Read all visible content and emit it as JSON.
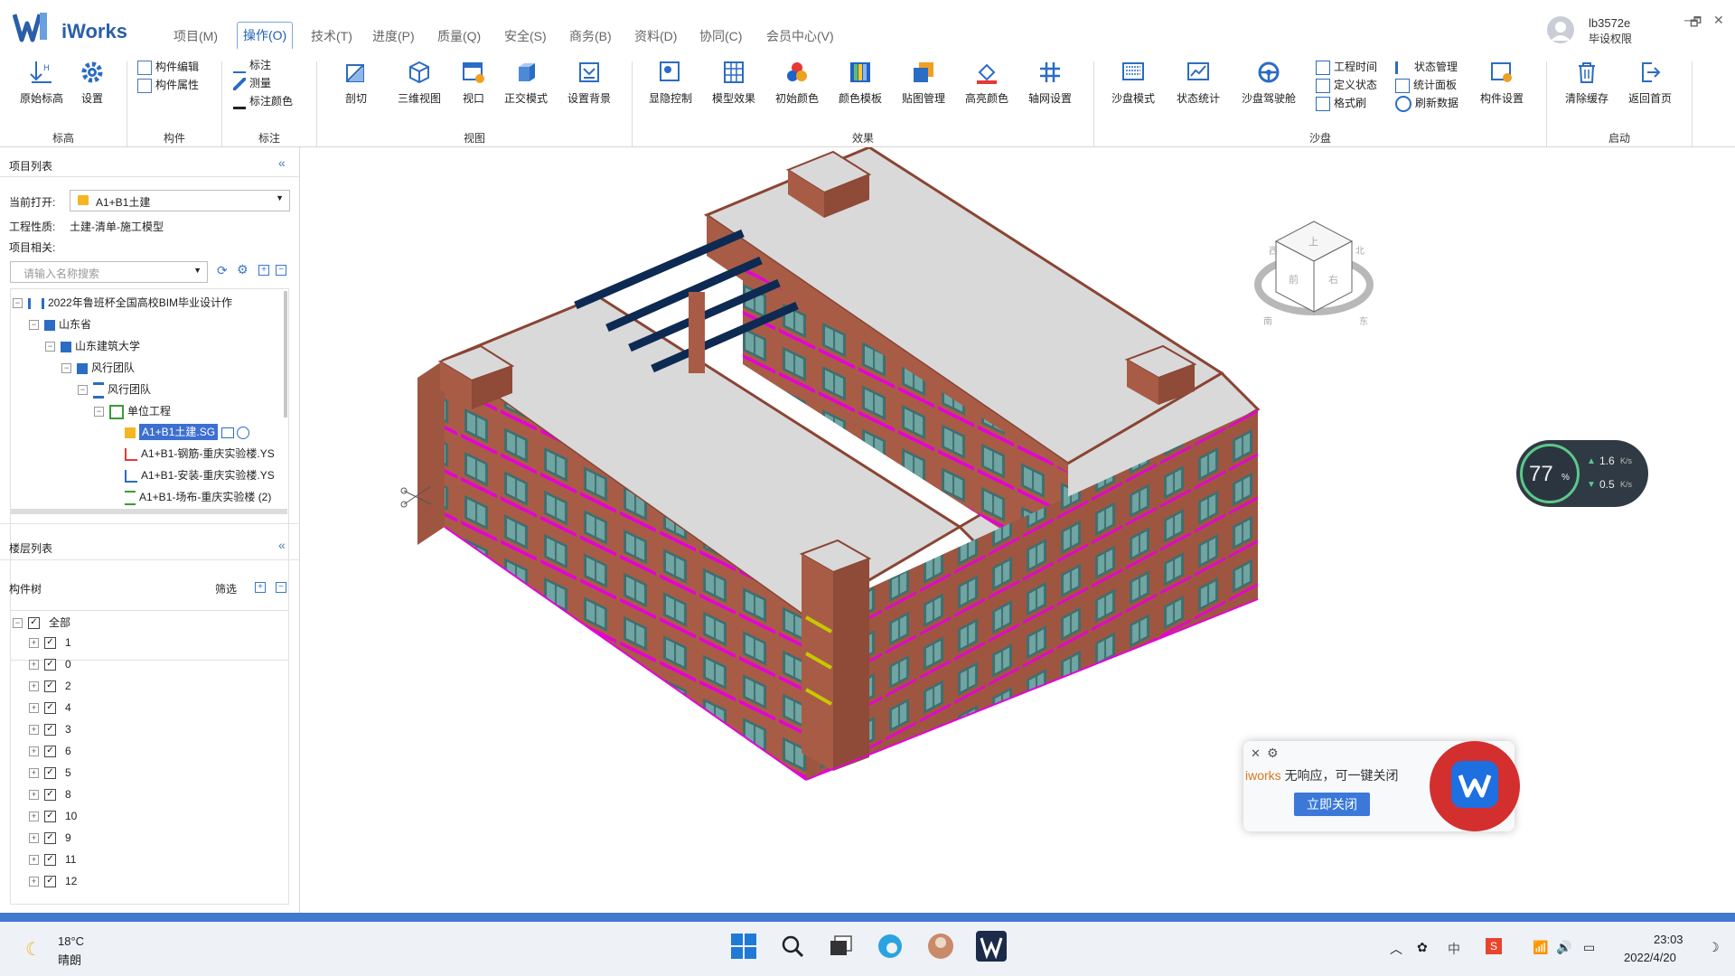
{
  "app": {
    "name": "iWorks"
  },
  "menu": [
    {
      "label": "项目(M)",
      "active": false
    },
    {
      "label": "操作(O)",
      "active": true
    },
    {
      "label": "技术(T)",
      "active": false
    },
    {
      "label": "进度(P)",
      "active": false
    },
    {
      "label": "质量(Q)",
      "active": false
    },
    {
      "label": "安全(S)",
      "active": false
    },
    {
      "label": "商务(B)",
      "active": false
    },
    {
      "label": "资料(D)",
      "active": false
    },
    {
      "label": "协同(C)",
      "active": false
    },
    {
      "label": "会员中心(V)",
      "active": false
    }
  ],
  "user": {
    "name": "lb3572e",
    "role": "毕设权限"
  },
  "ribbon": {
    "elevation": {
      "label": "标高",
      "buttons": [
        "原始标高",
        "设置"
      ]
    },
    "component": {
      "label": "构件",
      "items": [
        "构件编辑",
        "构件属性"
      ]
    },
    "annotation": {
      "label": "标注",
      "items": [
        "标注",
        "测量",
        "标注颜色"
      ]
    },
    "view": {
      "label": "视图",
      "buttons": [
        "剖切",
        "三维视图",
        "视口",
        "正交模式",
        "设置背景"
      ]
    },
    "effect": {
      "label": "效果",
      "buttons": [
        "显隐控制",
        "模型效果",
        "初始颜色",
        "颜色模板",
        "贴图管理",
        "高亮颜色",
        "轴网设置"
      ]
    },
    "sandbox": {
      "label": "沙盘",
      "buttons": [
        "沙盘模式",
        "状态统计",
        "沙盘驾驶舱"
      ],
      "items1": [
        "工程时间",
        "定义状态",
        "格式刷"
      ],
      "items2": [
        "状态管理",
        "统计面板",
        "刷新数据"
      ],
      "last": "构件设置"
    },
    "startup": {
      "label": "启动",
      "buttons": [
        "清除缓存",
        "返回首页"
      ]
    }
  },
  "project_panel": {
    "title": "项目列表",
    "current_label": "当前打开:",
    "current_value": "A1+B1土建",
    "nature_label": "工程性质:",
    "nature_value": "土建-清单-施工模型",
    "related_label": "项目相关:",
    "search_placeholder": "请输入名称搜索",
    "tree": [
      {
        "label": "2022年鲁班杯全国高校BIM毕业设计作",
        "level": 0
      },
      {
        "label": "山东省",
        "level": 1
      },
      {
        "label": "山东建筑大学",
        "level": 2
      },
      {
        "label": "风行团队",
        "level": 3
      },
      {
        "label": "风行团队",
        "level": 4
      },
      {
        "label": "单位工程",
        "level": 5
      },
      {
        "label": "A1+B1土建.SG",
        "level": 6,
        "selected": true
      },
      {
        "label": "A1+B1-钢筋-重庆实验楼.YS",
        "level": 6
      },
      {
        "label": "A1+B1-安装-重庆实验楼.YS",
        "level": 6
      },
      {
        "label": "A1+B1-场布-重庆实验楼 (2)",
        "level": 6
      }
    ]
  },
  "floor_panel": {
    "title": "楼层列表",
    "tree_label": "构件树",
    "filter_label": "筛选",
    "items": [
      "全部",
      "1",
      "0",
      "2",
      "4",
      "3",
      "6",
      "5",
      "8",
      "10",
      "9",
      "11",
      "12"
    ]
  },
  "net_widget": {
    "percent": "77",
    "percent_unit": "%",
    "up": "1.6",
    "down": "0.5",
    "unit": "K/s"
  },
  "notification": {
    "app": "iworks",
    "message": "无响应，可一键关闭",
    "button": "立即关闭"
  },
  "viewcube": {
    "faces": [
      "上",
      "前",
      "右"
    ],
    "compass": [
      "西",
      "北",
      "东",
      "南"
    ]
  },
  "taskbar": {
    "weather_temp": "18°C",
    "weather_desc": "晴朗",
    "ime": "中",
    "time": "23:03",
    "date": "2022/4/20"
  },
  "colors": {
    "accent": "#1f5fb4",
    "building_wall": "#b5664f",
    "roof": "#d9d9d9",
    "glass": "#5a8c8c",
    "magenta": "#e600d8"
  }
}
